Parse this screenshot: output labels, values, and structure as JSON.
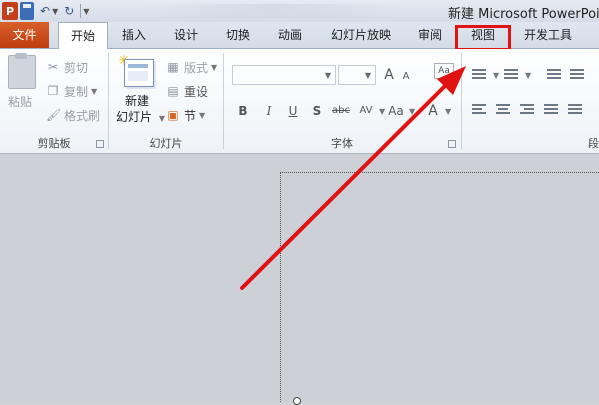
{
  "window": {
    "title": "新建 Microsoft PowerPoin",
    "app_icon_letter": "P"
  },
  "quick_access": {
    "undo_glyph": "↶",
    "redo_glyph": "↻"
  },
  "tabs": [
    {
      "label": "文件",
      "active": false
    },
    {
      "label": "开始",
      "active": true
    },
    {
      "label": "插入",
      "active": false
    },
    {
      "label": "设计",
      "active": false
    },
    {
      "label": "切换",
      "active": false
    },
    {
      "label": "动画",
      "active": false
    },
    {
      "label": "幻灯片放映",
      "active": false
    },
    {
      "label": "审阅",
      "active": false
    },
    {
      "label": "视图",
      "active": false,
      "highlighted": true
    },
    {
      "label": "开发工具",
      "active": false
    }
  ],
  "ribbon": {
    "clipboard": {
      "label": "剪贴板",
      "paste": "粘贴",
      "cut": "剪切",
      "copy": "复制",
      "format_painter": "格式刷"
    },
    "slides": {
      "label": "幻灯片",
      "new_slide_line1": "新建",
      "new_slide_line2": "幻灯片",
      "layout": "版式",
      "reset": "重设",
      "section": "节"
    },
    "font": {
      "label": "字体",
      "bold": "B",
      "italic": "I",
      "underline": "U",
      "shadow": "S",
      "strikethrough": "abc",
      "spacing": "AV",
      "case": "Aa",
      "grow": "A",
      "shrink": "A",
      "color": "A"
    },
    "paragraph": {
      "label": "段"
    }
  },
  "annotation": {
    "highlight_color": "#e11212",
    "arrow_color": "#e11212"
  }
}
